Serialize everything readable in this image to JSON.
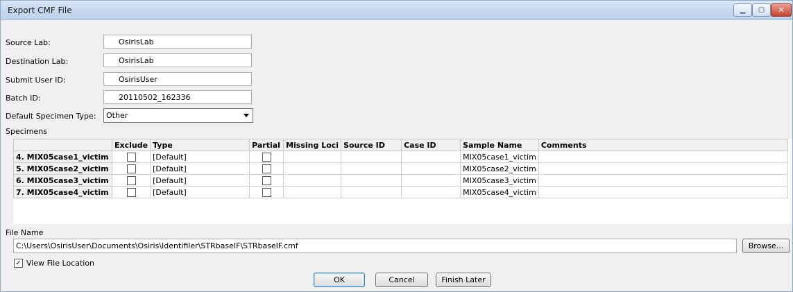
{
  "window": {
    "title": "Export CMF File",
    "min_glyph": "▁",
    "max_glyph": "▢",
    "close_glyph": "✕"
  },
  "form": {
    "source_lab": {
      "label": "Source Lab:",
      "value": "OsirisLab"
    },
    "destination_lab": {
      "label": "Destination Lab:",
      "value": "OsirisLab"
    },
    "submit_user_id": {
      "label": "Submit User ID:",
      "value": "OsirisUser"
    },
    "batch_id": {
      "label": "Batch ID:",
      "value": "20110502_162336"
    },
    "default_specimen_type": {
      "label": "Default Specimen Type:",
      "value": "Other"
    }
  },
  "specimens": {
    "label": "Specimens",
    "columns": [
      "Exclude",
      "Type",
      "Partial",
      "Missing Loci",
      "Source ID",
      "Case ID",
      "Sample Name",
      "Comments"
    ],
    "rows": [
      {
        "name": "4. MIX05case1_victim",
        "type": "[Default]",
        "missing_loci": "",
        "source_id": "",
        "case_id": "",
        "sample_name": "MIX05case1_victim",
        "comments": ""
      },
      {
        "name": "5. MIX05case2_victim",
        "type": "[Default]",
        "missing_loci": "",
        "source_id": "",
        "case_id": "",
        "sample_name": "MIX05case2_victim",
        "comments": ""
      },
      {
        "name": "6. MIX05case3_victim",
        "type": "[Default]",
        "missing_loci": "",
        "source_id": "",
        "case_id": "",
        "sample_name": "MIX05case3_victim",
        "comments": ""
      },
      {
        "name": "7. MIX05case4_victim",
        "type": "[Default]",
        "missing_loci": "",
        "source_id": "",
        "case_id": "",
        "sample_name": "MIX05case4_victim",
        "comments": ""
      }
    ]
  },
  "file": {
    "label": "File Name",
    "path": "C:\\Users\\OsirisUser\\Documents\\Osiris\\Identifiler\\STRbaseIF\\STRbaseIF.cmf",
    "browse_label": "Browse..."
  },
  "view_location": {
    "label": "View File Location",
    "checked_glyph": "✓"
  },
  "buttons": {
    "ok": "OK",
    "cancel": "Cancel",
    "finish_later": "Finish Later"
  }
}
